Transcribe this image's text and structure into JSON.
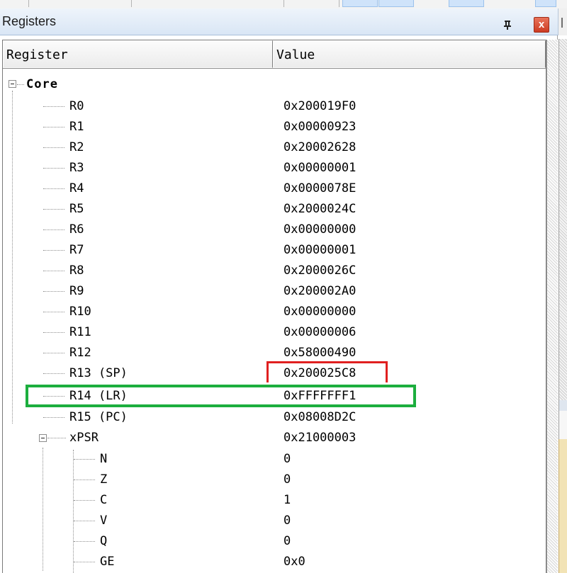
{
  "window": {
    "title": "Registers",
    "pin_icon": "pin-icon",
    "close_icon": "close-icon",
    "close_glyph": "x"
  },
  "columns": {
    "register": "Register",
    "value": "Value"
  },
  "tree": {
    "group": "Core",
    "registers": [
      {
        "name": "R0",
        "value": "0x200019F0"
      },
      {
        "name": "R1",
        "value": "0x00000923"
      },
      {
        "name": "R2",
        "value": "0x20002628"
      },
      {
        "name": "R3",
        "value": "0x00000001"
      },
      {
        "name": "R4",
        "value": "0x0000078E"
      },
      {
        "name": "R5",
        "value": "0x2000024C"
      },
      {
        "name": "R6",
        "value": "0x00000000"
      },
      {
        "name": "R7",
        "value": "0x00000001"
      },
      {
        "name": "R8",
        "value": "0x2000026C"
      },
      {
        "name": "R9",
        "value": "0x200002A0"
      },
      {
        "name": "R10",
        "value": "0x00000000"
      },
      {
        "name": "R11",
        "value": "0x00000006"
      },
      {
        "name": "R12",
        "value": "0x58000490"
      },
      {
        "name": "R13 (SP)",
        "value": "0x200025C8"
      },
      {
        "name": "R14 (LR)",
        "value": "0xFFFFFFF1"
      },
      {
        "name": "R15 (PC)",
        "value": "0x08008D2C"
      }
    ],
    "xpsr": {
      "name": "xPSR",
      "value": "0x21000003",
      "flags": [
        {
          "name": "N",
          "value": "0"
        },
        {
          "name": "Z",
          "value": "0"
        },
        {
          "name": "C",
          "value": "1"
        },
        {
          "name": "V",
          "value": "0"
        },
        {
          "name": "Q",
          "value": "0"
        },
        {
          "name": "GE",
          "value": "0x0"
        }
      ]
    }
  },
  "annotations": {
    "red_box_color": "#e02020",
    "green_box_color": "#1cae3e"
  }
}
